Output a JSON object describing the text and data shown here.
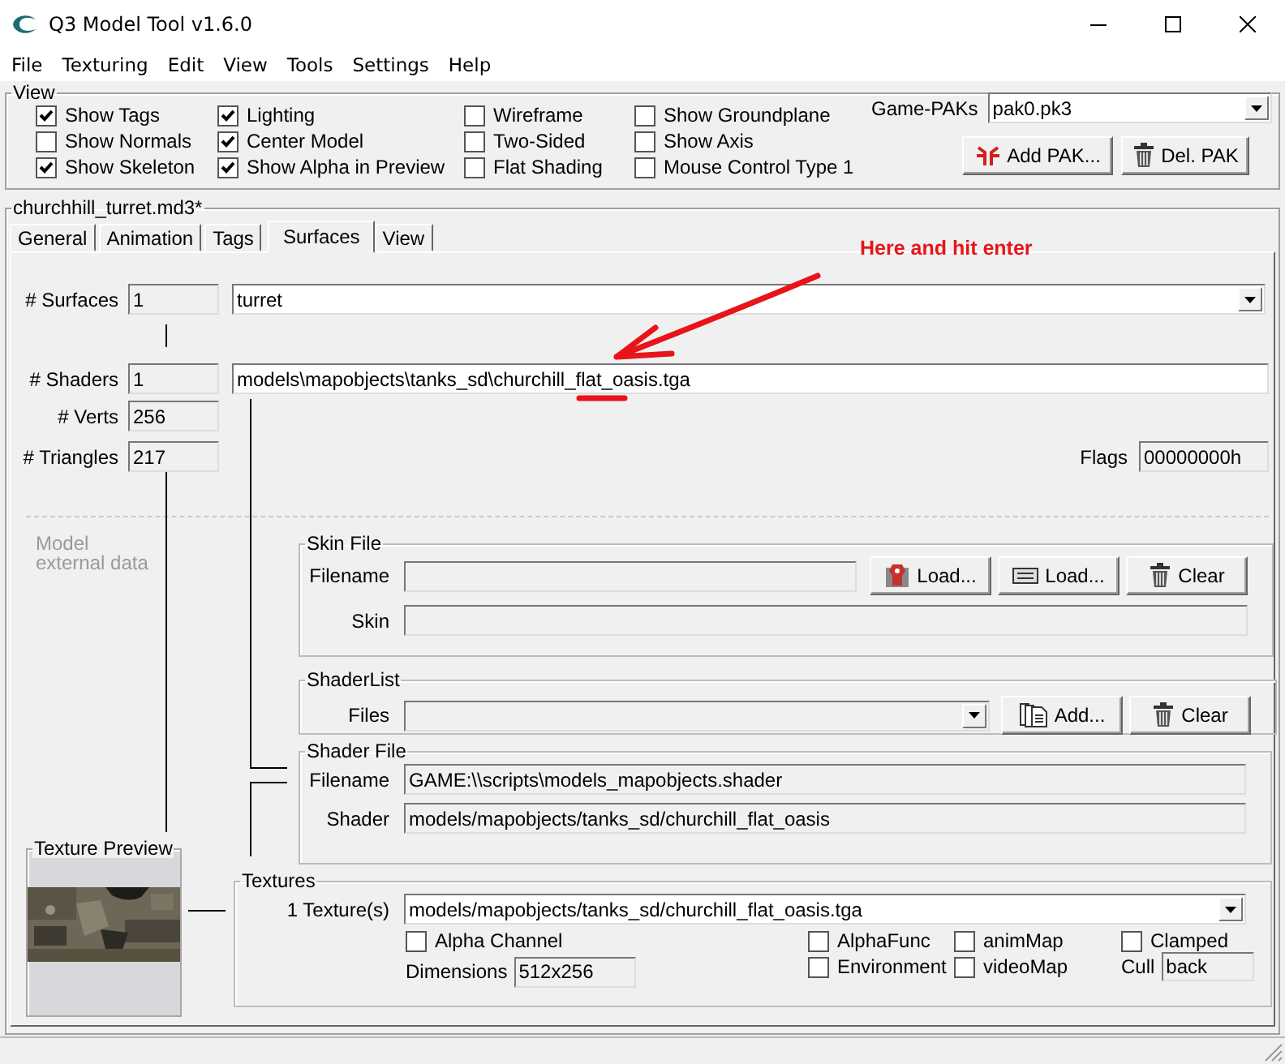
{
  "window": {
    "title": "Q3 Model Tool v1.6.0"
  },
  "menu": [
    "File",
    "Texturing",
    "Edit",
    "View",
    "Tools",
    "Settings",
    "Help"
  ],
  "view": {
    "title": "View",
    "columns": [
      [
        {
          "label": "Show Tags",
          "checked": true
        },
        {
          "label": "Show Normals",
          "checked": false
        },
        {
          "label": "Show Skeleton",
          "checked": true
        }
      ],
      [
        {
          "label": "Lighting",
          "checked": true
        },
        {
          "label": "Center Model",
          "checked": true
        },
        {
          "label": "Show Alpha in Preview",
          "checked": true
        }
      ],
      [
        {
          "label": "Wireframe",
          "checked": false
        },
        {
          "label": "Two-Sided",
          "checked": false
        },
        {
          "label": "Flat Shading",
          "checked": false
        }
      ],
      [
        {
          "label": "Show Groundplane",
          "checked": false
        },
        {
          "label": "Show Axis",
          "checked": false
        },
        {
          "label": "Mouse Control Type 1",
          "checked": false
        }
      ]
    ],
    "game_paks_label": "Game-PAKs",
    "game_paks": "pak0.pk3",
    "add_pak": "Add PAK...",
    "del_pak": "Del. PAK"
  },
  "file": {
    "title": "churchhill_turret.md3*"
  },
  "tabs": [
    {
      "label": "General",
      "selected": false
    },
    {
      "label": "Animation",
      "selected": false
    },
    {
      "label": "Tags",
      "selected": false
    },
    {
      "label": "Surfaces",
      "selected": true
    },
    {
      "label": "View",
      "selected": false
    }
  ],
  "surfaces": {
    "surfaces_label": "# Surfaces",
    "surfaces_count": "1",
    "surface_name": "turret",
    "shaders_label": "# Shaders",
    "shaders_count": "1",
    "shader_name": "models\\mapobjects\\tanks_sd\\churchill_flat_oasis.tga",
    "verts_label": "# Verts",
    "verts": "256",
    "triangles_label": "# Triangles",
    "triangles": "217",
    "flags_label": "Flags",
    "flags": "00000000h",
    "external_note": "Model\nexternal data"
  },
  "skin_file": {
    "title": "Skin File",
    "filename_label": "Filename",
    "load_skin": "Load...",
    "load_text": "Load...",
    "clear": "Clear",
    "skin_label": "Skin"
  },
  "shader_list": {
    "title": "ShaderList",
    "files_label": "Files",
    "add": "Add...",
    "clear": "Clear"
  },
  "shader_file": {
    "title": "Shader File",
    "filename_label": "Filename",
    "filename": "GAME:\\\\scripts\\models_mapobjects.shader",
    "shader_label": "Shader",
    "shader": "models/mapobjects/tanks_sd/churchill_flat_oasis"
  },
  "texture_preview": {
    "title": "Texture Preview"
  },
  "textures": {
    "title": "Textures",
    "count_label": "1 Texture(s)",
    "texture": "models/mapobjects/tanks_sd/churchill_flat_oasis.tga",
    "alpha_channel": {
      "label": "Alpha Channel",
      "checked": false
    },
    "alpha_func": {
      "label": "AlphaFunc",
      "checked": false
    },
    "environment": {
      "label": "Environment",
      "checked": false
    },
    "anim_map": {
      "label": "animMap",
      "checked": false
    },
    "video_map": {
      "label": "videoMap",
      "checked": false
    },
    "clamped": {
      "label": "Clamped",
      "checked": false
    },
    "dimensions_label": "Dimensions",
    "dimensions": "512x256",
    "cull_label": "Cull",
    "cull": "back"
  },
  "annotation": {
    "text": "Here and hit enter"
  }
}
